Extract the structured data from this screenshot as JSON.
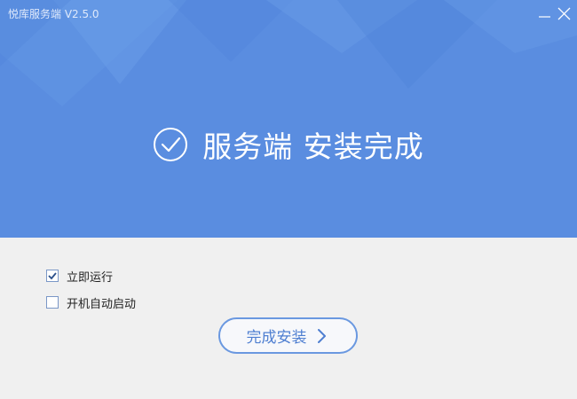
{
  "window": {
    "title": "悦库服务端 V2.5.0",
    "accent_color": "#5a8de0"
  },
  "controls": {
    "minimize_icon": "minimize-icon",
    "close_icon": "close-icon"
  },
  "hero": {
    "icon": "check-circle-icon",
    "message": "服务端 安装完成"
  },
  "options": [
    {
      "label": "立即运行",
      "checked": true
    },
    {
      "label": "开机自动启动",
      "checked": false
    }
  ],
  "finish_button": {
    "label": "完成安装",
    "icon": "chevron-right-icon"
  }
}
